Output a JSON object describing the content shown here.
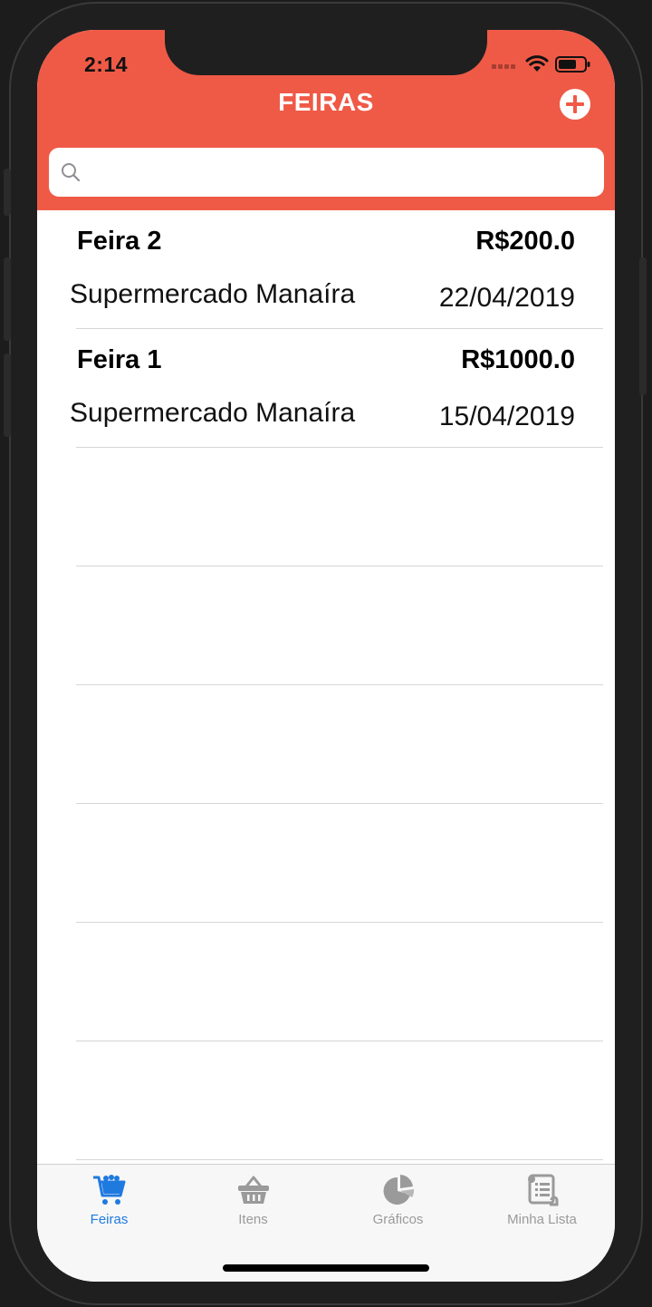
{
  "theme": {
    "accent": "#ef5a47",
    "tab_active": "#1f7ae0",
    "tab_inactive": "#9a9a9a"
  },
  "status_bar": {
    "time": "2:14"
  },
  "header": {
    "title": "FEIRAS",
    "add_icon": "plus-circle-icon"
  },
  "search": {
    "placeholder": "",
    "value": "",
    "icon": "search-icon"
  },
  "feiras": [
    {
      "name": "Feira 2",
      "price": "R$200.0",
      "market": "Supermercado Manaíra",
      "date": "22/04/2019"
    },
    {
      "name": "Feira 1",
      "price": "R$1000.0",
      "market": "Supermercado Manaíra",
      "date": "15/04/2019"
    }
  ],
  "tabs": [
    {
      "label": "Feiras",
      "icon": "cart-icon",
      "active": true
    },
    {
      "label": "Itens",
      "icon": "basket-icon",
      "active": false
    },
    {
      "label": "Gráficos",
      "icon": "pie-chart-icon",
      "active": false
    },
    {
      "label": "Minha Lista",
      "icon": "list-scroll-icon",
      "active": false
    }
  ]
}
